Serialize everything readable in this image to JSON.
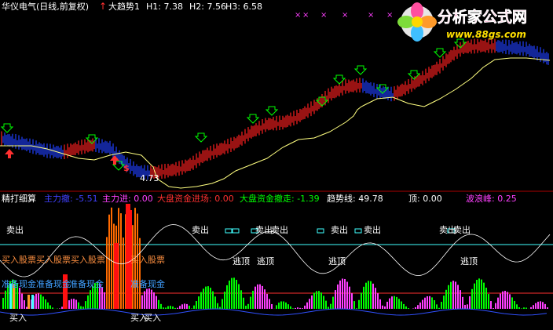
{
  "title": {
    "stock_name": "华仪电气(日线,前复权)",
    "indicator_name": "大趋势1",
    "h1": "H1: 7.38",
    "h2": "H2: 7.56",
    "h3": "H3: 6.58"
  },
  "main_chart": {
    "low_marker": "$",
    "low_price": "4.73"
  },
  "logo": {
    "name": "分析家公式网",
    "url": "www.88gs.com"
  },
  "sub_header": {
    "name": "精打细算",
    "zhulisun": "主力撤: -5.51",
    "zhulijin": "主力进: 0.00",
    "dapan_in": "大盘资金进场: 0.00",
    "dapan_out": "大盘资金撤走: -1.39",
    "trend": "趋势线: 49.78",
    "top": "顶: 0.00",
    "wave": "波浪峰: 0.25"
  },
  "sub_chart": {
    "sell": "卖出",
    "buy": "买入",
    "buy_stock": "买入股票",
    "prep_cash": "准备现金",
    "escape": "逃顶"
  },
  "colors": {
    "up": "#ff2020",
    "down": "#2040ff",
    "ma": "#ffff80",
    "arrow_up": "#00ff00",
    "arrow_down": "#ff3030",
    "cyan": "#40ffff",
    "green": "#00ff00",
    "magenta": "#ff40ff"
  }
}
